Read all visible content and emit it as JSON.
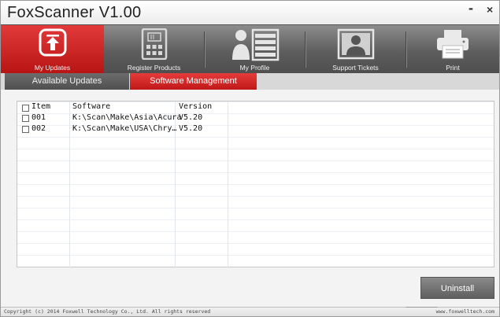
{
  "window": {
    "title": "FoxScanner  V1.00",
    "minimize": "-",
    "close": "×"
  },
  "nav": {
    "items": [
      {
        "label": "My Updates",
        "icon": "upload-arrow-icon"
      },
      {
        "label": "Register Products",
        "icon": "register-calculator-icon"
      },
      {
        "label": "My Profile",
        "icon": "profile-icon"
      },
      {
        "label": "Support Tickets",
        "icon": "support-person-icon"
      },
      {
        "label": "Print",
        "icon": "printer-icon"
      }
    ]
  },
  "subtabs": {
    "available": "Available Updates",
    "management": "Software Management"
  },
  "table": {
    "headers": {
      "item": "Item",
      "software": "Software",
      "version": "Version"
    },
    "rows": [
      {
        "item": "001",
        "software": "K:\\Scan\\Make\\Asia\\Acura",
        "version": "V5.20"
      },
      {
        "item": "002",
        "software": "K:\\Scan\\Make\\USA\\Chry…",
        "version": "V5.20"
      }
    ]
  },
  "actions": {
    "uninstall": "Uninstall"
  },
  "status": {
    "copyright": "Copyright (c) 2014 Foxwell Technology Co., Ltd. All rights reserved",
    "website": "www.foxwelltech.com"
  },
  "colors": {
    "accent": "#d12222",
    "nav_bg": "#5e5e5e",
    "button_bg": "#6f6f6f"
  }
}
